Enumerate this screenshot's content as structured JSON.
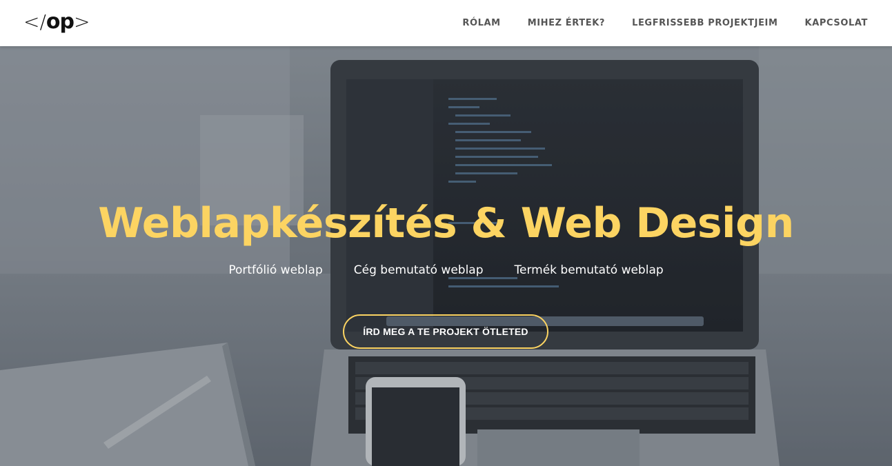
{
  "header": {
    "logo": {
      "left_bracket": "</",
      "text": "op",
      "right_bracket": ">"
    },
    "nav": [
      {
        "label": "RÓLAM"
      },
      {
        "label": "MIHEZ ÉRTEK?"
      },
      {
        "label": "LEGFRISSEBB PROJEKTJEIM"
      },
      {
        "label": "KAPCSOLAT"
      }
    ]
  },
  "hero": {
    "title": "Weblapkészítés & Web Design",
    "subtitles": [
      "Portfólió weblap",
      "Cég bemutató weblap",
      "Termék bemutató weblap"
    ],
    "cta_label": "ÍRD MEG A TE PROJEKT ÖTLETED"
  },
  "colors": {
    "accent": "#fcd462",
    "header_bg": "#ffffff",
    "nav_text": "#555555",
    "hero_text": "#ffffff"
  }
}
